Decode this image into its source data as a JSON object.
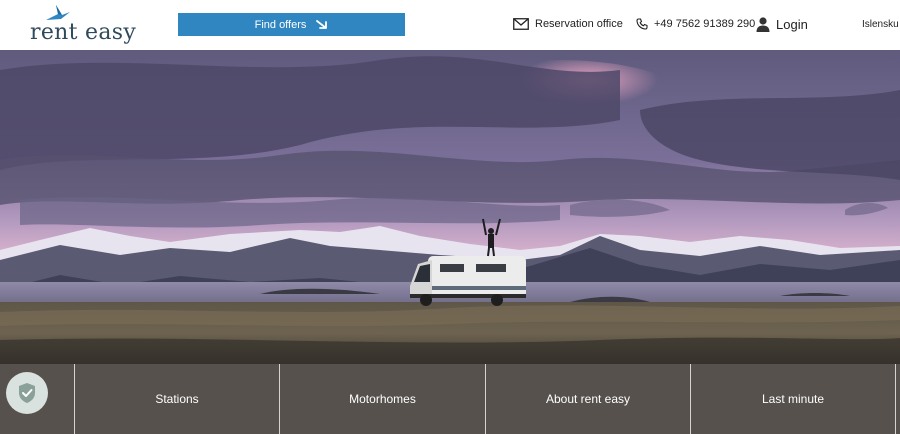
{
  "brand": {
    "name": "rent easy",
    "accent": "#2f86c1",
    "dark": "#2f4a5c"
  },
  "header": {
    "find_offers": "Find offers",
    "reservation": "Reservation office",
    "phone": "+49 7562 91389 290",
    "login": "Login",
    "language": "Islensku"
  },
  "bottom_nav": {
    "items": [
      {
        "label": "Stations"
      },
      {
        "label": "Motorhomes"
      },
      {
        "label": "About rent easy"
      },
      {
        "label": "Last minute"
      }
    ]
  },
  "icons": {
    "find": "arrow-icon",
    "reservation": "envelope-icon",
    "phone": "phone-icon",
    "login": "user-icon",
    "privacy": "shield-icon"
  }
}
